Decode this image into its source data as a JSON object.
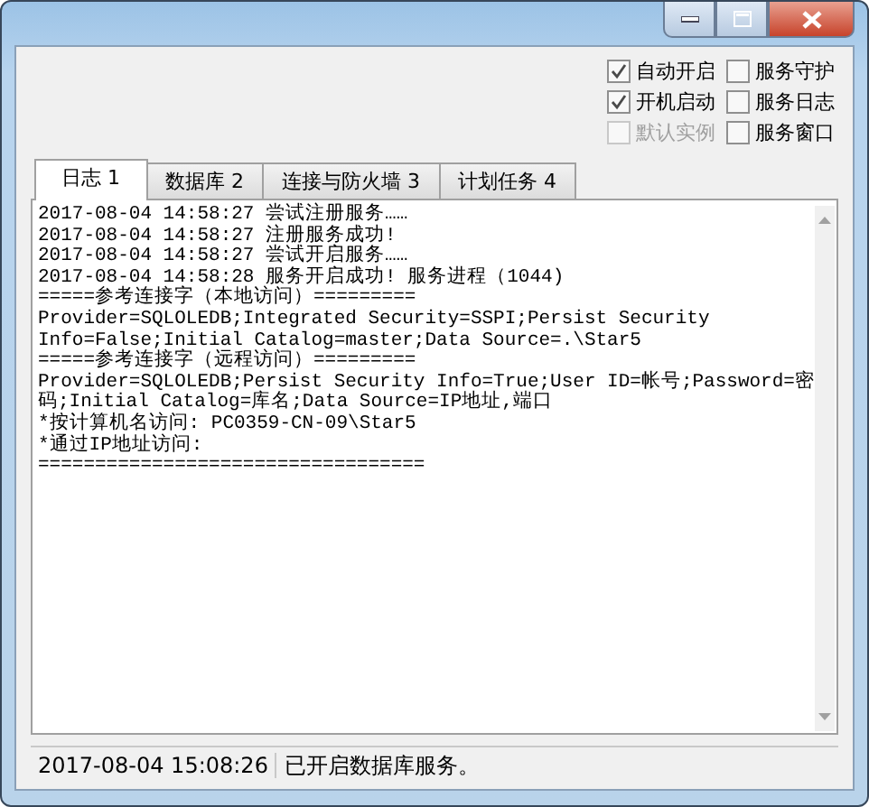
{
  "options": [
    {
      "label": "自动开启",
      "checked": true,
      "disabled": false
    },
    {
      "label": "服务守护",
      "checked": false,
      "disabled": false
    },
    {
      "label": "开机启动",
      "checked": true,
      "disabled": false
    },
    {
      "label": "服务日志",
      "checked": false,
      "disabled": false
    },
    {
      "label": "默认实例",
      "checked": false,
      "disabled": true
    },
    {
      "label": "服务窗口",
      "checked": false,
      "disabled": false
    }
  ],
  "tabs": [
    {
      "label": "日志 1",
      "selected": true
    },
    {
      "label": "数据库 2",
      "selected": false
    },
    {
      "label": "连接与防火墙 3",
      "selected": false
    },
    {
      "label": "计划任务 4",
      "selected": false
    }
  ],
  "log_lines": [
    "2017-08-04 14:58:27 尝试注册服务……",
    "2017-08-04 14:58:27 注册服务成功!",
    "2017-08-04 14:58:27 尝试开启服务……",
    "2017-08-04 14:58:28 服务开启成功! 服务进程（1044)",
    "=====参考连接字（本地访问）=========",
    "Provider=SQLOLEDB;Integrated Security=SSPI;Persist Security",
    "Info=False;Initial Catalog=master;Data Source=.\\Star5",
    "=====参考连接字（远程访问）=========",
    "Provider=SQLOLEDB;Persist Security Info=True;User ID=帐号;Password=密",
    "码;Initial Catalog=库名;Data Source=IP地址,端口",
    "*按计算机名访问: PC0359-CN-09\\Star5",
    "*通过IP地址访问:",
    "=================================="
  ],
  "status_bar": {
    "time": "2017-08-04 15:08:26",
    "message": "已开启数据库服务。"
  }
}
